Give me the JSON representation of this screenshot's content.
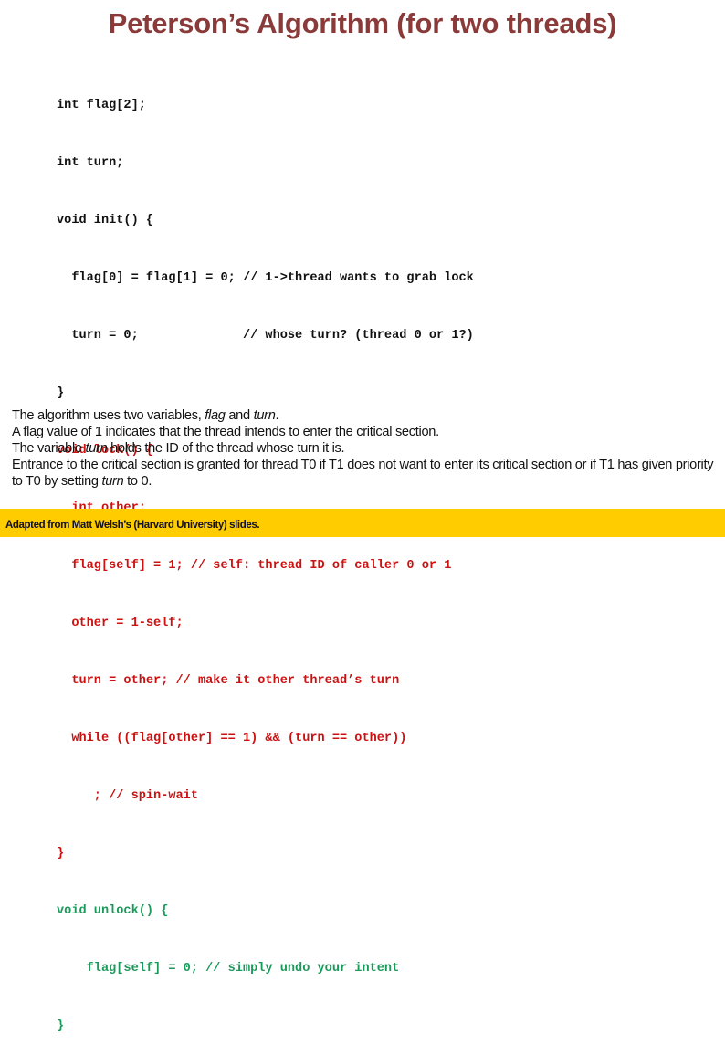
{
  "title": "Peterson’s Algorithm (for two threads)",
  "code": {
    "globals": [
      "int flag[2];",
      "int turn;",
      "void init() {",
      "  flag[0] = flag[1] = 0; // 1->thread wants to grab lock",
      "  turn = 0;              // whose turn? (thread 0 or 1?)",
      "}"
    ],
    "lock": [
      "void lock() {",
      "  int other;",
      "  flag[self] = 1; // self: thread ID of caller 0 or 1",
      "  other = 1-self;",
      "  turn = other; // make it other thread’s turn",
      "  while ((flag[other] == 1) && (turn == other))",
      "     ; // spin-wait",
      "}"
    ],
    "unlock": [
      "void unlock() {",
      "    flag[self] = 0; // simply undo your intent",
      "}"
    ],
    "colors": {
      "globals": "#111111",
      "lock": "#cc1111",
      "unlock": "#1a9a5a"
    }
  },
  "description": {
    "line1": {
      "a": "The algorithm uses two variables, ",
      "b": "flag",
      "c": " and ",
      "d": "turn",
      "e": "."
    },
    "line2": "A flag value of 1 indicates that the thread intends to enter the critical section.",
    "line3": {
      "a": "The variable ",
      "b": "turn",
      "c": " holds the ID of the thread whose turn it is."
    },
    "line4": {
      "a": "Entrance to the critical section is granted for thread T0 if T1 does not want to enter its critical section or if T1 has given priority to T0 by setting ",
      "b": "turn",
      "c": " to 0."
    }
  },
  "footer": {
    "text": "Adapted from Matt Welsh’s (Harvard University) slides.",
    "background": "#ffcc00"
  }
}
